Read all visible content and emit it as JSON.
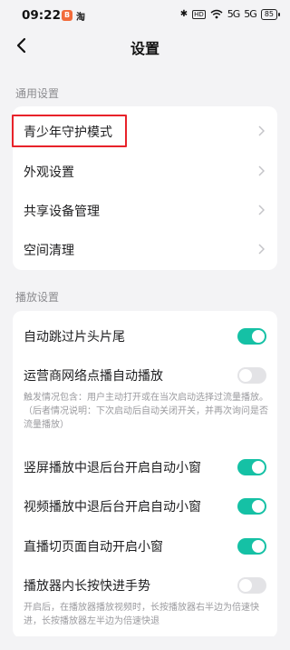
{
  "status_bar": {
    "time": "09:22",
    "app_badge_1": "B",
    "app_badge_2": "淘",
    "bluetooth": "✱",
    "hd": "HD",
    "wifi": "WiFi",
    "signal_1": "5G",
    "signal_2": "5G",
    "battery": "85"
  },
  "header": {
    "title": "设置"
  },
  "sections": {
    "general": {
      "label": "通用设置",
      "items": [
        {
          "label": "青少年守护模式"
        },
        {
          "label": "外观设置"
        },
        {
          "label": "共享设备管理"
        },
        {
          "label": "空间清理"
        }
      ]
    },
    "playback": {
      "label": "播放设置",
      "items": [
        {
          "label": "自动跳过片头片尾",
          "on": true
        },
        {
          "label": "运营商网络点播自动播放",
          "on": false,
          "desc": "触发情况包含：用户主动打开或在当次启动选择过流量播放。（后者情况说明：下次启动后自动关闭开关，并再次询问是否流量播放）"
        },
        {
          "label": "竖屏播放中退后台开启自动小窗",
          "on": true
        },
        {
          "label": "视频播放中退后台开启自动小窗",
          "on": true
        },
        {
          "label": "直播切页面自动开启小窗",
          "on": true
        },
        {
          "label": "播放器内长按快进手势",
          "on": false,
          "desc": "开启后，在播放器播放视频时，长按播放器右半边为倍速快进，长按播放器左半边为倍速快退"
        }
      ]
    }
  },
  "colors": {
    "accent": "#15c1a5",
    "highlight": "#e8222a",
    "background": "#f3f3f5"
  }
}
